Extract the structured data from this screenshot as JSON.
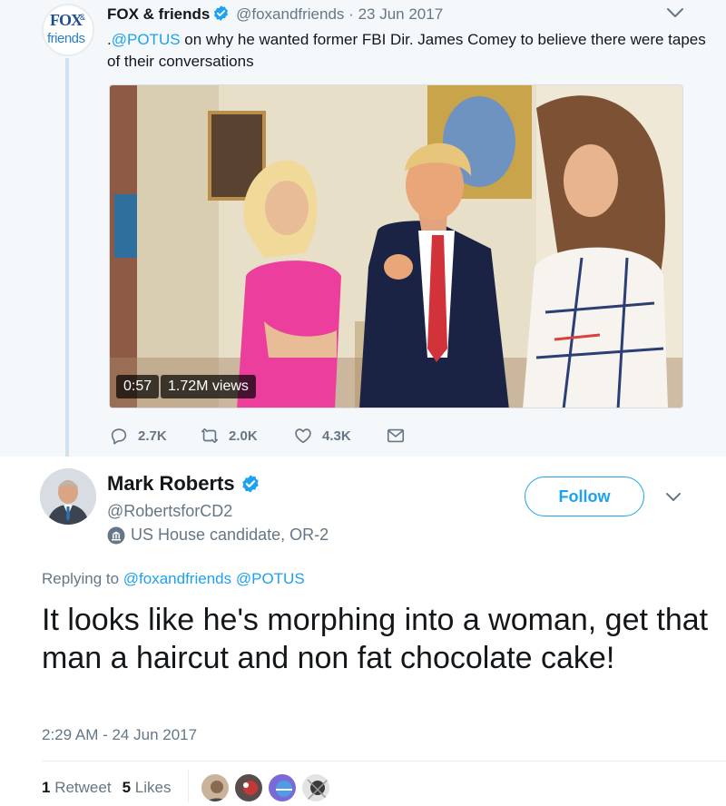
{
  "parent_tweet": {
    "author_name": "FOX & friends",
    "avatar_text_top": "FOX",
    "avatar_text_amp": "&",
    "avatar_text_bottom": "friends",
    "handle": "@foxandfriends",
    "separator": "·",
    "date": "23 Jun 2017",
    "text_prefix": ".",
    "mention": "@POTUS",
    "text_rest": " on why he wanted former FBI Dir. James Comey to believe there were tapes of their conversations",
    "video": {
      "duration": "0:57",
      "views": "1.72M views"
    },
    "actions": {
      "replies": "2.7K",
      "retweets": "2.0K",
      "likes": "4.3K"
    },
    "icons": [
      "reply-icon",
      "retweet-icon",
      "like-icon",
      "message-icon",
      "chevron-down-icon",
      "verified-badge-icon"
    ]
  },
  "reply_tweet": {
    "author_name": "Mark Roberts",
    "handle": "@RobertsforCD2",
    "label": "US House candidate, OR-2",
    "follow_label": "Follow",
    "replying_prefix": "Replying to ",
    "replying_to": [
      "@foxandfriends",
      "@POTUS"
    ],
    "text": "It looks like he's morphing into a woman, get that man a haircut and non fat chocolate cake!",
    "timestamp": "2:29 AM - 24 Jun 2017",
    "stats": {
      "retweet_count": "1",
      "retweet_label": " Retweet",
      "like_count": "5",
      "like_label": " Likes"
    },
    "liker_avatars": 4
  },
  "colors": {
    "accent": "#1da1f2",
    "muted_text": "#657786",
    "parent_background": "#f5f8fa",
    "thread_line": "#cfe2ef"
  }
}
